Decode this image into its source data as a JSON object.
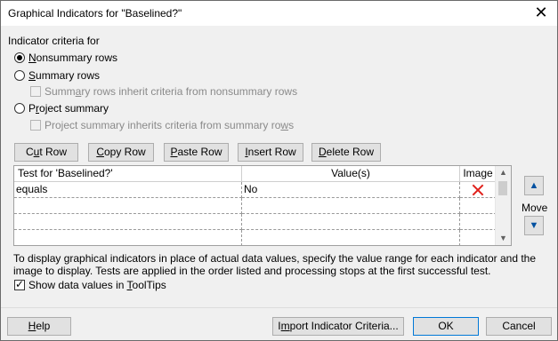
{
  "title": "Graphical Indicators for \"Baselined?\"",
  "criteria": {
    "label": "Indicator criteria for",
    "options": [
      {
        "pre": "",
        "ul": "N",
        "post": "onsummary rows",
        "selected": true
      },
      {
        "pre": "",
        "ul": "S",
        "post": "ummary rows",
        "selected": false
      },
      {
        "pre": "P",
        "ul": "r",
        "post": "oject summary",
        "selected": false
      }
    ],
    "summary_inherit": {
      "pre": "Summ",
      "ul": "a",
      "post": "ry rows inherit criteria from nonsummary rows"
    },
    "project_inherit": {
      "pre": "Project summary inherits criteria from summary ro",
      "ul": "w",
      "post": "s"
    }
  },
  "toolbar": [
    {
      "pre": "C",
      "ul": "u",
      "post": "t Row"
    },
    {
      "pre": "",
      "ul": "C",
      "post": "opy Row"
    },
    {
      "pre": "",
      "ul": "P",
      "post": "aste Row"
    },
    {
      "pre": "",
      "ul": "I",
      "post": "nsert Row"
    },
    {
      "pre": "",
      "ul": "D",
      "post": "elete Row"
    }
  ],
  "table": {
    "headers": [
      "Test for 'Baselined?'",
      "Value(s)",
      "Image"
    ],
    "rows": [
      {
        "test": "equals",
        "value": "No",
        "image": "red-x-icon"
      },
      {
        "test": "",
        "value": "",
        "image": ""
      },
      {
        "test": "",
        "value": "",
        "image": ""
      },
      {
        "test": "",
        "value": "",
        "image": ""
      }
    ]
  },
  "move_label": "Move",
  "description": "To display graphical indicators in place of actual data values, specify the value range for each indicator and the image to display.  Tests are applied in the order listed and processing stops at the first successful test.",
  "description_line1": "To display graphical indicators in place of actual data values, specify the value range for each indicator and the",
  "description_line2": "image to display.  Tests are applied in the order listed and processing stops at the first successful test.",
  "show_values": {
    "pre": "Show data values in ",
    "ul": "T",
    "post": "oolTips",
    "checked": true
  },
  "footer": {
    "help": {
      "pre": "",
      "ul": "H",
      "post": "elp"
    },
    "import": {
      "pre": "I",
      "ul": "m",
      "post": "port Indicator Criteria..."
    },
    "ok": "OK",
    "cancel": "Cancel"
  },
  "colors": {
    "accent": "#0078d7",
    "indicator_red": "#e0201b",
    "dialog_bg": "#f0f0f0"
  }
}
